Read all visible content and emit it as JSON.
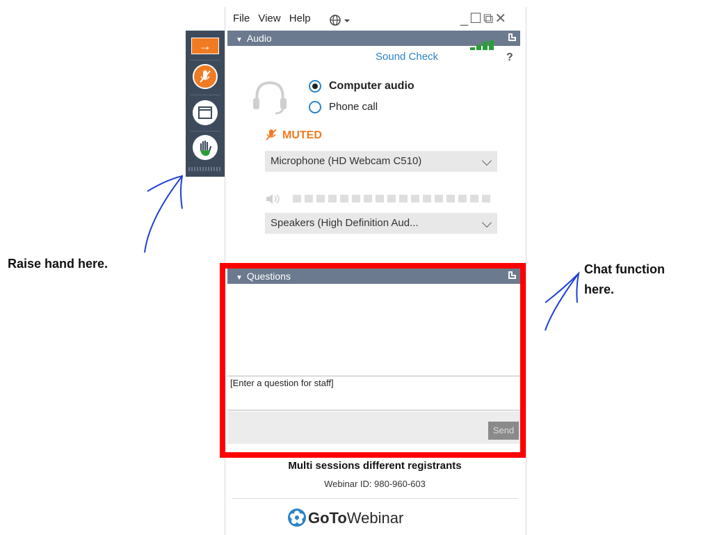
{
  "menu": {
    "file": "File",
    "view": "View",
    "help": "Help"
  },
  "window_controls": "_☐⧉✕",
  "audio": {
    "header": "Audio",
    "sound_check": "Sound Check",
    "help_mark": "?",
    "options": [
      "Computer audio",
      "Phone call"
    ],
    "selected_option": "Computer audio",
    "mic_status": "MUTED",
    "microphone": "Microphone (HD Webcam C510)",
    "speakers": "Speakers (High Definition Aud...",
    "meter_color": "#2a9d3a"
  },
  "questions": {
    "header": "Questions",
    "placeholder": "[Enter a question for staff]",
    "send_label": "Send"
  },
  "session": {
    "title": "Multi sessions different registrants",
    "webinar_id": "Webinar ID: 980-960-603"
  },
  "brand": {
    "go_to": "GoTo",
    "webinar": "Webinar"
  },
  "annotations": {
    "raise_hand": "Raise hand here.",
    "chat_line1": "Chat function",
    "chat_line2": "here."
  },
  "colors": {
    "accent": "#f07b22",
    "header_bg": "#6b7a8e",
    "toolbar_bg": "#3d4a5c",
    "link": "#2a83c7",
    "highlight": "#ff0000",
    "annotation_pen": "#1f3fd6"
  },
  "icons": [
    "arrow-right-icon",
    "muted-mic-icon",
    "window-icon",
    "raise-hand-icon",
    "headset-icon",
    "globe-icon",
    "speaker-icon",
    "gotowebinar-logo-icon"
  ]
}
